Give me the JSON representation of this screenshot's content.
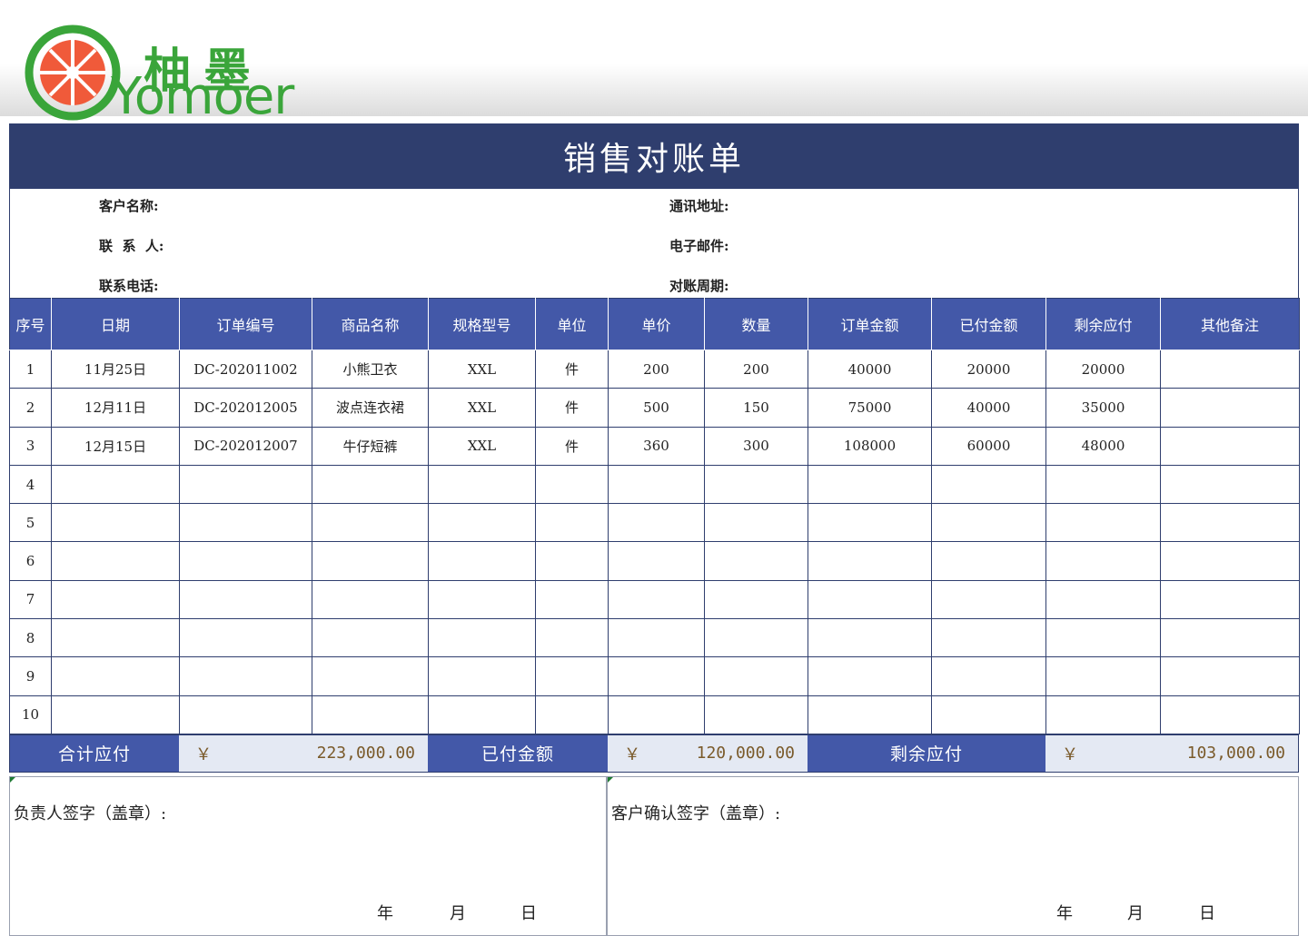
{
  "logo": {
    "cn": "柚墨",
    "en": "Yomoer"
  },
  "title": "销售对账单",
  "info": {
    "customer_name": "客户名称:",
    "contact": "联  系  人:",
    "phone": "联系电话:",
    "address": "通讯地址:",
    "email": "电子邮件:",
    "period": "对账周期:"
  },
  "columns": [
    "序号",
    "日期",
    "订单编号",
    "商品名称",
    "规格型号",
    "单位",
    "单价",
    "数量",
    "订单金额",
    "已付金额",
    "剩余应付",
    "其他备注"
  ],
  "rows": [
    [
      "1",
      "11月25日",
      "DC-202011002",
      "小熊卫衣",
      "XXL",
      "件",
      "200",
      "200",
      "40000",
      "20000",
      "20000",
      ""
    ],
    [
      "2",
      "12月11日",
      "DC-202012005",
      "波点连衣裙",
      "XXL",
      "件",
      "500",
      "150",
      "75000",
      "40000",
      "35000",
      ""
    ],
    [
      "3",
      "12月15日",
      "DC-202012007",
      "牛仔短裤",
      "XXL",
      "件",
      "360",
      "300",
      "108000",
      "60000",
      "48000",
      ""
    ],
    [
      "4",
      "",
      "",
      "",
      "",
      "",
      "",
      "",
      "",
      "",
      "",
      ""
    ],
    [
      "5",
      "",
      "",
      "",
      "",
      "",
      "",
      "",
      "",
      "",
      "",
      ""
    ],
    [
      "6",
      "",
      "",
      "",
      "",
      "",
      "",
      "",
      "",
      "",
      "",
      ""
    ],
    [
      "7",
      "",
      "",
      "",
      "",
      "",
      "",
      "",
      "",
      "",
      "",
      ""
    ],
    [
      "8",
      "",
      "",
      "",
      "",
      "",
      "",
      "",
      "",
      "",
      "",
      ""
    ],
    [
      "9",
      "",
      "",
      "",
      "",
      "",
      "",
      "",
      "",
      "",
      "",
      ""
    ],
    [
      "10",
      "",
      "",
      "",
      "",
      "",
      "",
      "",
      "",
      "",
      "",
      ""
    ]
  ],
  "totals": {
    "total_label": "合计应付",
    "total_symbol": "￥",
    "total_value": "223,000.00",
    "paid_label": "已付金额",
    "paid_symbol": "￥",
    "paid_value": "120,000.00",
    "remaining_label": "剩余应付",
    "remaining_symbol": "￥",
    "remaining_value": "103,000.00"
  },
  "sign": {
    "left_label": "负责人签字（盖章）:",
    "right_label": "客户确认签字（盖章）:",
    "year": "年",
    "month": "月",
    "day": "日"
  },
  "colors": {
    "header": "#2f3e6e",
    "column_header": "#4358a8",
    "logo_green": "#3aa53a",
    "logo_orange": "#f05a3a"
  }
}
